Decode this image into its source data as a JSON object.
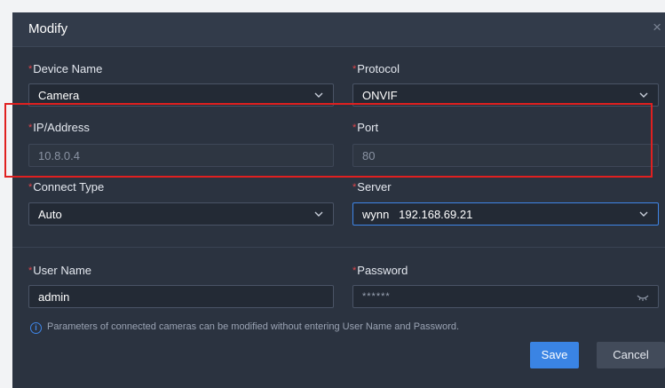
{
  "dialog": {
    "title": "Modify",
    "close_glyph": "×"
  },
  "required_mark": "*",
  "fields": {
    "device_name": {
      "label": "Device Name",
      "value": "Camera",
      "type": "select"
    },
    "protocol": {
      "label": "Protocol",
      "value": "ONVIF",
      "type": "select"
    },
    "ip_address": {
      "label": "IP/Address",
      "value": "10.8.0.4",
      "type": "input",
      "disabled": true
    },
    "port": {
      "label": "Port",
      "value": "80",
      "type": "input",
      "disabled": true
    },
    "connect_type": {
      "label": "Connect Type",
      "value": "Auto",
      "type": "select"
    },
    "server": {
      "label": "Server",
      "value": "wynn   192.168.69.21",
      "type": "select",
      "focused": true
    },
    "user_name": {
      "label": "User Name",
      "value": "admin",
      "type": "input"
    },
    "password": {
      "label": "Password",
      "value": "******",
      "type": "password"
    }
  },
  "info": {
    "icon": "info-icon",
    "text": "Parameters of connected cameras can be modified without entering User Name and Password."
  },
  "buttons": {
    "save": "Save",
    "cancel": "Cancel"
  },
  "colors": {
    "dialog_bg": "#2b3340",
    "accent": "#3a84e4",
    "required": "#e0464c",
    "highlight": "#e02020"
  }
}
